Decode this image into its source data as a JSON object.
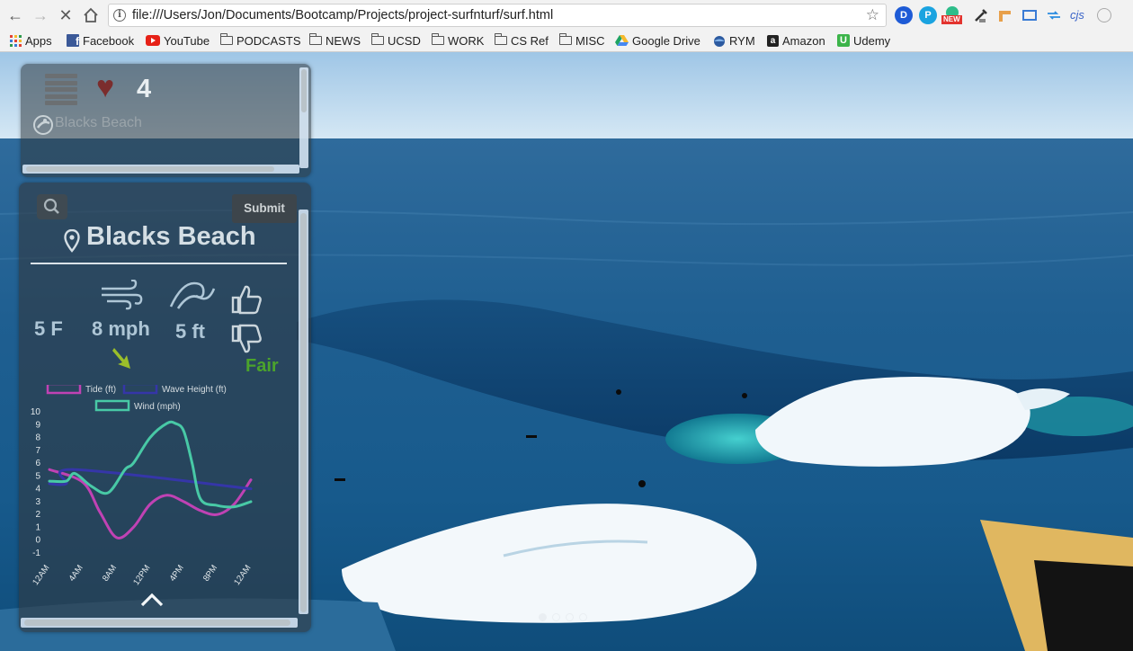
{
  "browser": {
    "url": "file:///Users/Jon/Documents/Bootcamp/Projects/project-surfnturf/surf.html",
    "extension_icons": [
      "dashlane-icon",
      "pinterest-icon",
      "grammarly-new-icon",
      "eyedropper-icon",
      "ruler-icon",
      "screenshot-icon",
      "arrows-icon",
      "cjs-icon",
      "circle-icon"
    ],
    "extension_cjs_label": "cjs",
    "extension_new_badge": "NEW"
  },
  "bookmarks": [
    {
      "label": "Apps",
      "icon": "apps-grid-icon"
    },
    {
      "label": "Facebook",
      "icon": "facebook-icon"
    },
    {
      "label": "YouTube",
      "icon": "youtube-icon"
    },
    {
      "label": "PODCASTS",
      "icon": "folder-icon"
    },
    {
      "label": "NEWS",
      "icon": "folder-icon"
    },
    {
      "label": "UCSD",
      "icon": "folder-icon"
    },
    {
      "label": "WORK",
      "icon": "folder-icon"
    },
    {
      "label": "CS Ref",
      "icon": "folder-icon"
    },
    {
      "label": "MISC",
      "icon": "folder-icon"
    },
    {
      "label": "Google Drive",
      "icon": "google-drive-icon"
    },
    {
      "label": "RYM",
      "icon": "rym-icon"
    },
    {
      "label": "Amazon",
      "icon": "amazon-icon"
    },
    {
      "label": "Udemy",
      "icon": "udemy-icon"
    }
  ],
  "favorites": {
    "count": "4",
    "items": [
      "Blacks Beach"
    ]
  },
  "forecast": {
    "submit_label": "Submit",
    "location": "Blacks Beach",
    "temperature": "5 F",
    "wind": "8 mph",
    "wave_height": "5 ft",
    "rating": "Fair",
    "colors": {
      "rating": "#4ba32c",
      "wind_arrow": "#9bbf2a"
    }
  },
  "carousel": {
    "slides": 4,
    "active": 0
  },
  "chart_data": {
    "type": "line",
    "x": [
      "12AM",
      "4AM",
      "8AM",
      "12PM",
      "4PM",
      "8PM",
      "12AM"
    ],
    "ylim": [
      -1,
      10
    ],
    "yticks": [
      "10",
      "9",
      "8",
      "7",
      "6",
      "5",
      "4",
      "3",
      "2",
      "1",
      "0",
      "-1"
    ],
    "legend_position": "top",
    "series": [
      {
        "name": "Tide (ft)",
        "color": "#c042b4",
        "x_hours": [
          0,
          4,
          6,
          8,
          10,
          12,
          14,
          16,
          18,
          20,
          22,
          24
        ],
        "values": [
          5.5,
          4.5,
          2.2,
          0.2,
          1.0,
          2.8,
          3.5,
          3.0,
          2.3,
          2.0,
          2.8,
          4.7
        ]
      },
      {
        "name": "Wave Height (ft)",
        "color": "#3536a8",
        "x_hours": [
          0,
          2,
          3,
          24
        ],
        "values": [
          4.4,
          4.4,
          5.5,
          4.0
        ]
      },
      {
        "name": "Wind (mph)",
        "color": "#48c9a6",
        "x_hours": [
          0,
          2,
          3,
          5,
          7,
          9,
          10,
          12,
          14,
          15,
          16,
          17,
          18,
          20,
          22,
          24
        ],
        "values": [
          4.6,
          4.6,
          5.2,
          4.2,
          3.7,
          5.5,
          6.0,
          8.0,
          9.1,
          9.1,
          8.5,
          6.0,
          3.2,
          2.7,
          2.6,
          3.0
        ]
      }
    ]
  }
}
